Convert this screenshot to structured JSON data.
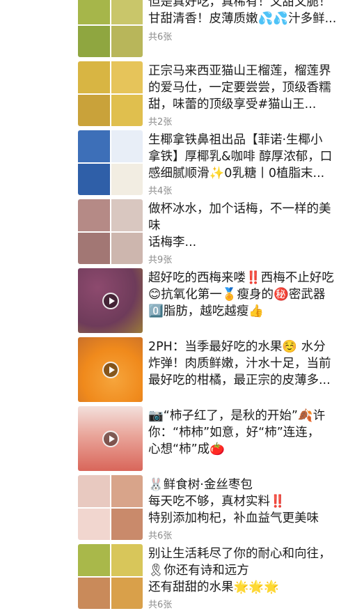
{
  "feed": [
    {
      "lines": [
        "但是真好吃，真稀有！又甜又脆！",
        "甘甜清香！皮薄质嫩💦💦汁多鲜..."
      ],
      "count": "共6张",
      "colors": [
        "#a6b64a",
        "#c9c66a",
        "#8fa640",
        "#b8b65a"
      ]
    },
    {
      "lines": [
        "正宗马来西亚猫山王榴莲，榴莲界",
        "的爱马仕，一定要尝尝，顶级香糯",
        "甜，味蕾的顶级享受#猫山王..."
      ],
      "count": "共2张",
      "colors": [
        "#d8b543",
        "#e6c45a",
        "#c9a23a",
        "#e0bf4e"
      ]
    },
    {
      "lines": [
        "生椰拿铁鼻祖出品【菲诺·生椰小",
        "拿铁】厚椰乳&咖啡 醇厚浓郁，口",
        "感细腻顺滑✨0乳糖丨0植脂末..."
      ],
      "count": "共4张",
      "colors": [
        "#3d6fb8",
        "#e8eef7",
        "#2f5fa8",
        "#f2ede2"
      ]
    },
    {
      "lines": [
        "做杯冰水，加个话梅，不一样的美",
        "味",
        "话梅李..."
      ],
      "count": "共9张",
      "colors": [
        "#b58a86",
        "#d9c7c0",
        "#a27774",
        "#cdb6ae"
      ]
    },
    {
      "lines": [
        "超好吃的西梅来喽‼️西梅不止好吃",
        "😊抗氧化第一🏅瘦身的㊙️密武器",
        "0️⃣脂肪，越吃越瘦👍"
      ],
      "count": "",
      "colors": [
        "#6e3b5a",
        "#8d4a6e"
      ],
      "video": true
    },
    {
      "lines": [
        "2PH：当季最好吃的水果☺️ 水分",
        "炸弹！肉质鲜嫩，汁水十足，当前",
        "最好吃的柑橘，最正宗的皮薄多..."
      ],
      "count": "",
      "colors": [
        "#f08a1c",
        "#f6a53c"
      ],
      "video": true
    },
    {
      "lines": [
        "📷“柿子红了，是秋的开始”🍂许",
        "你：“柿柿”如意，好“柿”连连，",
        "心想“柿”成🍅"
      ],
      "count": "",
      "colors": [
        "#d9665a",
        "#e9a59a"
      ],
      "video": true
    },
    {
      "lines": [
        "🐰鲜食树·金丝枣包",
        "每天吃不够，真材实料‼️",
        "特别添加枸杞，补血益气更美味"
      ],
      "count": "共6张",
      "colors": [
        "#e8c9c0",
        "#d8a48a",
        "#f1d6cf",
        "#c98a6b"
      ]
    },
    {
      "lines": [
        "别让生活耗尽了你的耐心和向往，",
        "🎗你还有诗和远方",
        "还有甜甜的水果🌟🌟🌟"
      ],
      "count": "共6张",
      "colors": [
        "#a9b84a",
        "#d8c65a",
        "#c98a5a",
        "#d9a04a"
      ]
    }
  ]
}
